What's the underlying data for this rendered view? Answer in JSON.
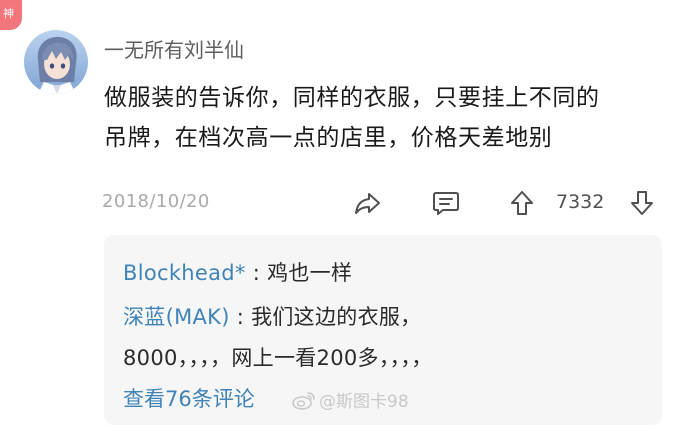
{
  "badge": {
    "label": "神"
  },
  "comment": {
    "username": "一无所有刘半仙",
    "content_lines": [
      "做服装的告诉你，同样的衣服，只要挂上不同的",
      "吊牌，在档次高一点的店里，价格天差地别"
    ],
    "date": "2018/10/20",
    "votes": "7332"
  },
  "replies": {
    "items": [
      {
        "author": "Blockhead*",
        "separator": " : ",
        "text": "鸡也一样"
      },
      {
        "author": "深蓝(MAK)",
        "separator": " : ",
        "text": "我们这边的衣服，",
        "continuation": "8000，，，，网上一看200多，，，，"
      }
    ],
    "view_more": "查看76条评论"
  },
  "watermark": {
    "text": "@斯图卡98"
  },
  "icons": {
    "share": "share-icon",
    "comment": "comment-icon",
    "upvote": "upvote-icon",
    "downvote": "downvote-icon",
    "weibo": "weibo-logo-icon"
  },
  "colors": {
    "badge": "#f2767c",
    "link": "#3f83b7",
    "muted": "#aaaaaa",
    "panel": "#f6f6f7"
  }
}
